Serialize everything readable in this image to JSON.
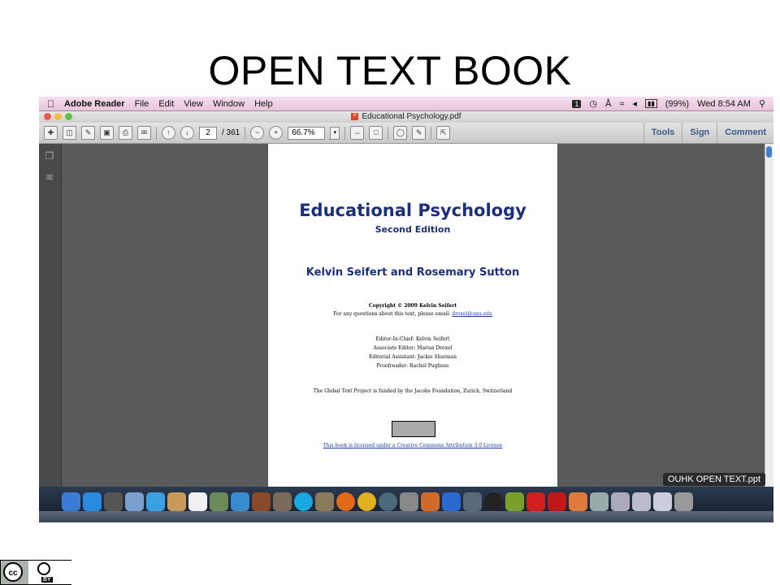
{
  "slide": {
    "title": "OPEN TEXT BOOK"
  },
  "menubar": {
    "app": "Adobe Reader",
    "items": [
      "File",
      "Edit",
      "View",
      "Window",
      "Help"
    ],
    "battery": "(99%)",
    "clock": "Wed 8:54 AM"
  },
  "window": {
    "title": "Educational Psychology.pdf"
  },
  "toolbar": {
    "page_current": "2",
    "page_total": "/ 361",
    "zoom": "66.7%",
    "tools_label": "Tools",
    "sign_label": "Sign",
    "comment_label": "Comment"
  },
  "document": {
    "title": "Educational Psychology",
    "edition": "Second Edition",
    "authors": "Kelvin Seifert and Rosemary Sutton",
    "copyright": "Copyright © 2009 Kelvin Seifert",
    "questions_text": "For any questions about this text, please email:",
    "email": "drexel@uga.edu",
    "credits": [
      "Editor-In-Chief: Kelvin Seifert",
      "Associate Editor: Marisa Drexel",
      "Editorial Assistant: Jackie Sharman",
      "Proofreader: Rachel Pugliese"
    ],
    "funding": "The Global Text Project is funded by the Jacobs Foundation, Zurich, Switzerland",
    "license": "This book is licensed under a Creative Commons Attribution 3.0 License"
  },
  "filename_tooltip": "OUHK OPEN TEXT.ppt",
  "cc_logo": {
    "cc": "cc",
    "by": "BY"
  },
  "colors": {
    "menubar": "#f0d2e4",
    "document_heading": "#1b2f7a",
    "viewer_bg": "#5a5a5a"
  }
}
